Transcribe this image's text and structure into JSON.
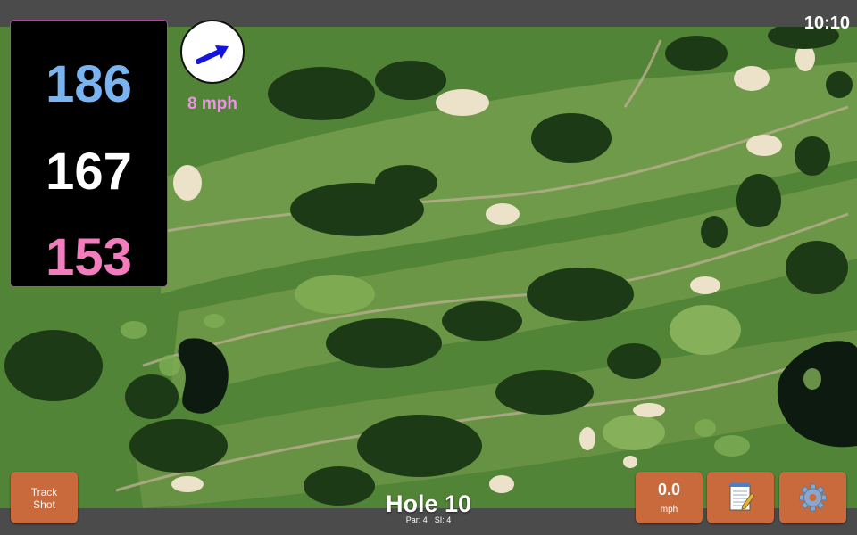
{
  "status": {
    "clock": "10:10"
  },
  "yardages": {
    "back": "186",
    "middle": "167",
    "front": "153"
  },
  "wind": {
    "speed": "8 mph",
    "direction_icon": "arrow-icon"
  },
  "hole": {
    "title": "Hole 10",
    "par": "Par: 4",
    "si": "SI: 4"
  },
  "buttons": {
    "track_shot_line1": "Track",
    "track_shot_line2": "Shot",
    "speed_value": "0.0",
    "speed_unit": "mph",
    "notes_icon": "notepad-icon",
    "settings_icon": "gear-icon"
  },
  "colors": {
    "back": "#7ab4f0",
    "middle": "#ffffff",
    "front": "#f27cbd",
    "wind_text": "#f090ea",
    "button": "#c96a3c"
  }
}
